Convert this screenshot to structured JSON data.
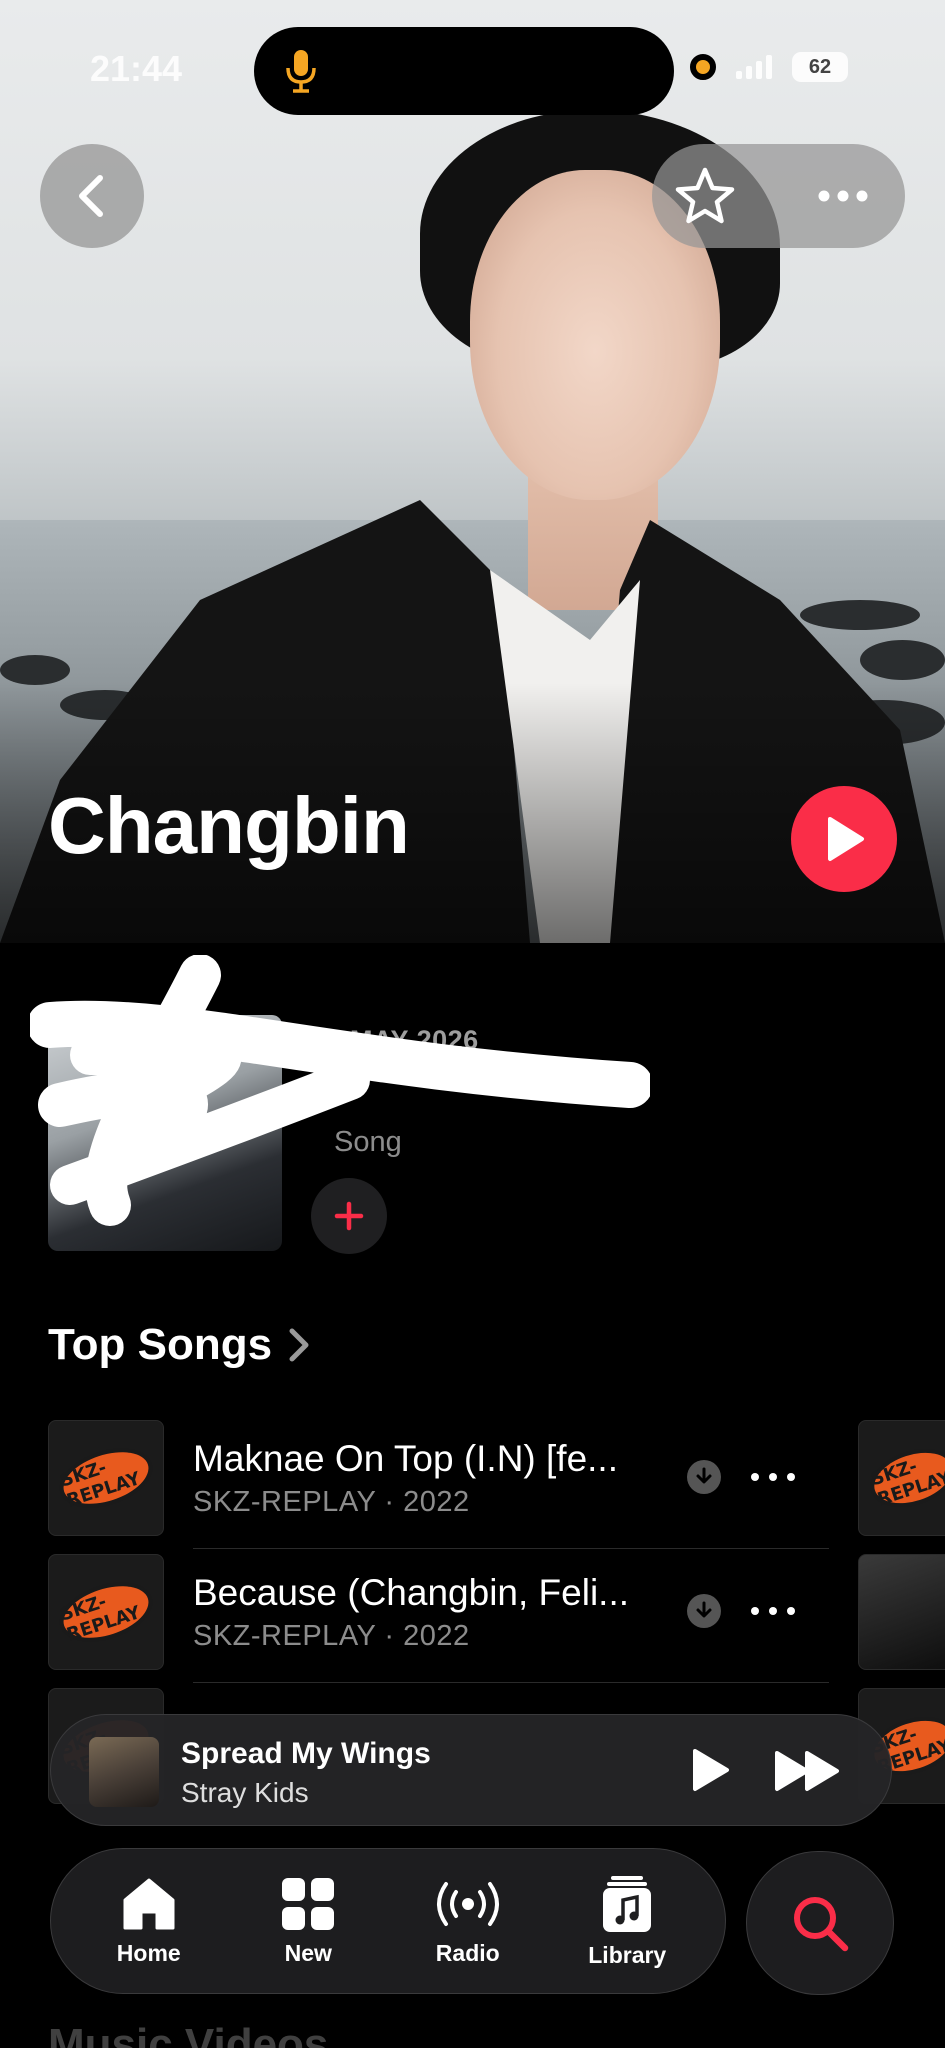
{
  "status_bar": {
    "time": "21:44",
    "battery": "62"
  },
  "artist": {
    "name": "Changbin"
  },
  "latest_release": {
    "date": "13 MAY 2026",
    "type": "Song"
  },
  "top_songs": {
    "title": "Top Songs",
    "items": [
      {
        "title": "Maknae On Top (I.N) [fe...",
        "subtitle": "SKZ-REPLAY · 2022"
      },
      {
        "title": "Because (Changbin, Feli...",
        "subtitle": "SKZ-REPLAY · 2022"
      }
    ]
  },
  "now_playing": {
    "title": "Spread My Wings",
    "artist": "Stray Kids"
  },
  "tabs": [
    {
      "label": "Home"
    },
    {
      "label": "New"
    },
    {
      "label": "Radio"
    },
    {
      "label": "Library"
    }
  ],
  "colors": {
    "accent": "#fa2d48",
    "background": "#000000"
  },
  "album_logo_text": "SKZ-REPLAY",
  "next_section_title": "Music Videos"
}
